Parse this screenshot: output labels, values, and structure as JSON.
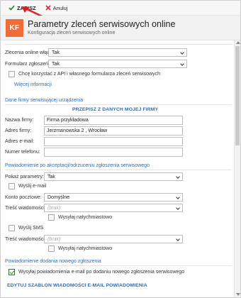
{
  "toolbar": {
    "save_label": "ZAPISZ",
    "cancel_label": "Anuluj"
  },
  "header": {
    "logo_text": "KF",
    "title": "Parametry zleceń serwisowych online",
    "subtitle": "Konfiguracja zleceń serwisowych online"
  },
  "general": {
    "orders_enabled_label": "Zlecenia online włączone:",
    "orders_enabled_value": "Tak",
    "form_enabled_label": "Formularz zgłoszeń włączony:",
    "form_enabled_value": "Tak",
    "api_checkbox_label": "Chcę korzystać z API i własnego formularza zleceń serwisowych",
    "more_info_link": "Więcej informacji"
  },
  "company": {
    "section_title": "Dane firmy serwisującej urządzenia",
    "copy_link": "PRZEPISZ Z DANYCH MOJEJ FIRMY",
    "name_label": "Nazwa firmy:",
    "name_value": "Firma przykładowa",
    "address_label": "Adres firmy:",
    "address_value": "Jerzmanowska 2 ,  Wrocław",
    "email_label": "Adres e-mail:",
    "email_value": "",
    "phone_label": "Numer telefonu:",
    "phone_value": ""
  },
  "notification": {
    "section_title": "Powiadomienie po akceptacji/odrzuceniu zgłoszenia serwisowego",
    "show_params_label": "Pokaż parametry:",
    "show_params_value": "Tak",
    "send_email_label": "Wyślij e-mail",
    "mail_account_label": "Konto pocztowe:",
    "mail_account_value": "Domyślne",
    "message_label": "Treść wiadomości:",
    "message_placeholder": "(brak)",
    "send_now_label": "Wysyłaj natychmiastowo",
    "send_sms_label": "Wyślij SMS",
    "sms_message_label": "Treść wiadomości:",
    "sms_message_placeholder": "(brak)",
    "sms_send_now_label": "Wysyłaj natychmiastowo"
  },
  "new_order": {
    "section_title": "Powiadomienie dodania nowego zgłoszenia",
    "send_checkbox_label": "Wysyłaj powiadomienia e-mail po dodaniu nowego zgłoszenia serwisowego",
    "edit_template_link": "EDYTUJ SZABLON WIADOMOŚCI E-MAIL POWIADOMIENIA"
  },
  "colors": {
    "accent": "#2a6db3",
    "logo_bg": "#f06d3a",
    "save_check": "#2e8b2e",
    "cancel_x": "#d9262c",
    "annotation_arrow": "#e02020"
  }
}
